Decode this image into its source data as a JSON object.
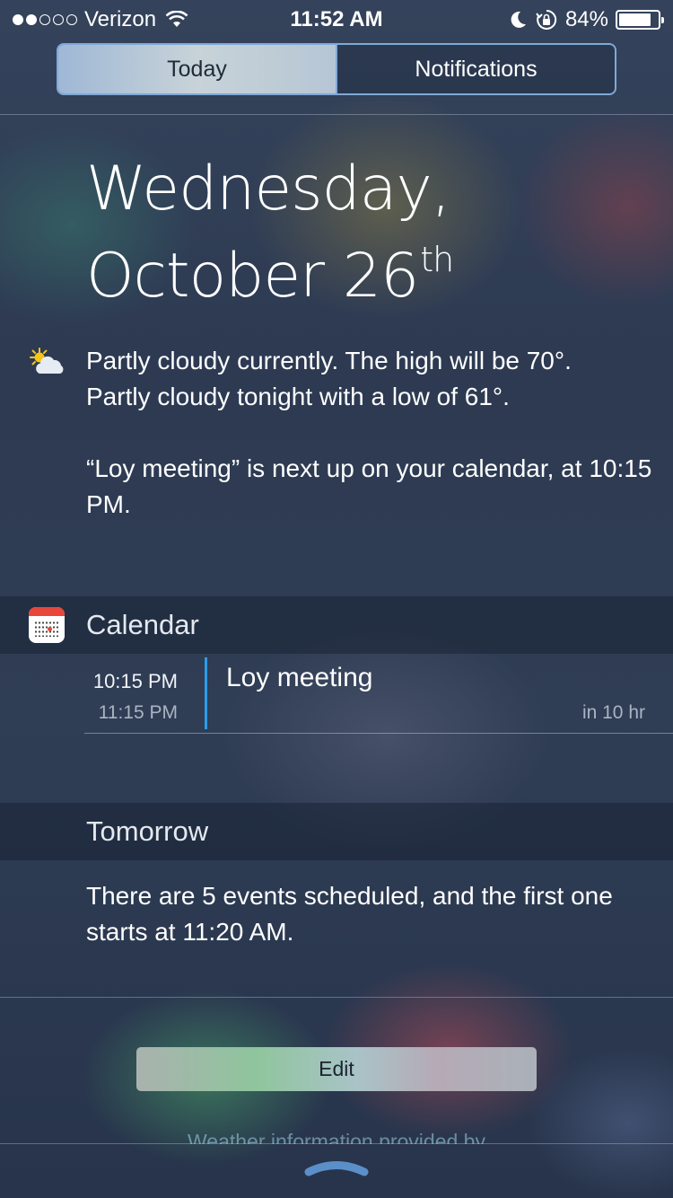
{
  "status_bar": {
    "carrier": "Verizon",
    "signal_bars": 2,
    "time": "11:52 AM",
    "battery": "84%",
    "battery_level": 0.84
  },
  "segmented_control": {
    "tabs": [
      {
        "label": "Today",
        "selected": true
      },
      {
        "label": "Notifications",
        "selected": false
      }
    ]
  },
  "date": {
    "line1": "Wednesday,",
    "line2": "October 26",
    "suffix": "th"
  },
  "summary": {
    "weather_line1": "Partly cloudy currently. The high will be 70°.",
    "weather_line2": "Partly cloudy tonight with a low of 61°.",
    "calendar_line": "“Loy meeting” is next up on your calendar, at 10:15 PM.",
    "weather_icon": "partly-cloudy-sun-icon"
  },
  "calendar_widget": {
    "title": "Calendar",
    "icon": "calendar-app-icon",
    "events": [
      {
        "start": "10:15 PM",
        "end": "11:15 PM",
        "title": "Loy meeting",
        "relative": "in 10 hr",
        "color": "#2d9ce8"
      }
    ]
  },
  "tomorrow_widget": {
    "title": "Tomorrow",
    "text": "There are 5 events scheduled, and the first one starts at 11:20 AM."
  },
  "footer": {
    "edit_label": "Edit",
    "credit": "Weather information provided by"
  },
  "colors": {
    "accent": "#2d9ce8",
    "segment_border": "#7fa9d8"
  }
}
